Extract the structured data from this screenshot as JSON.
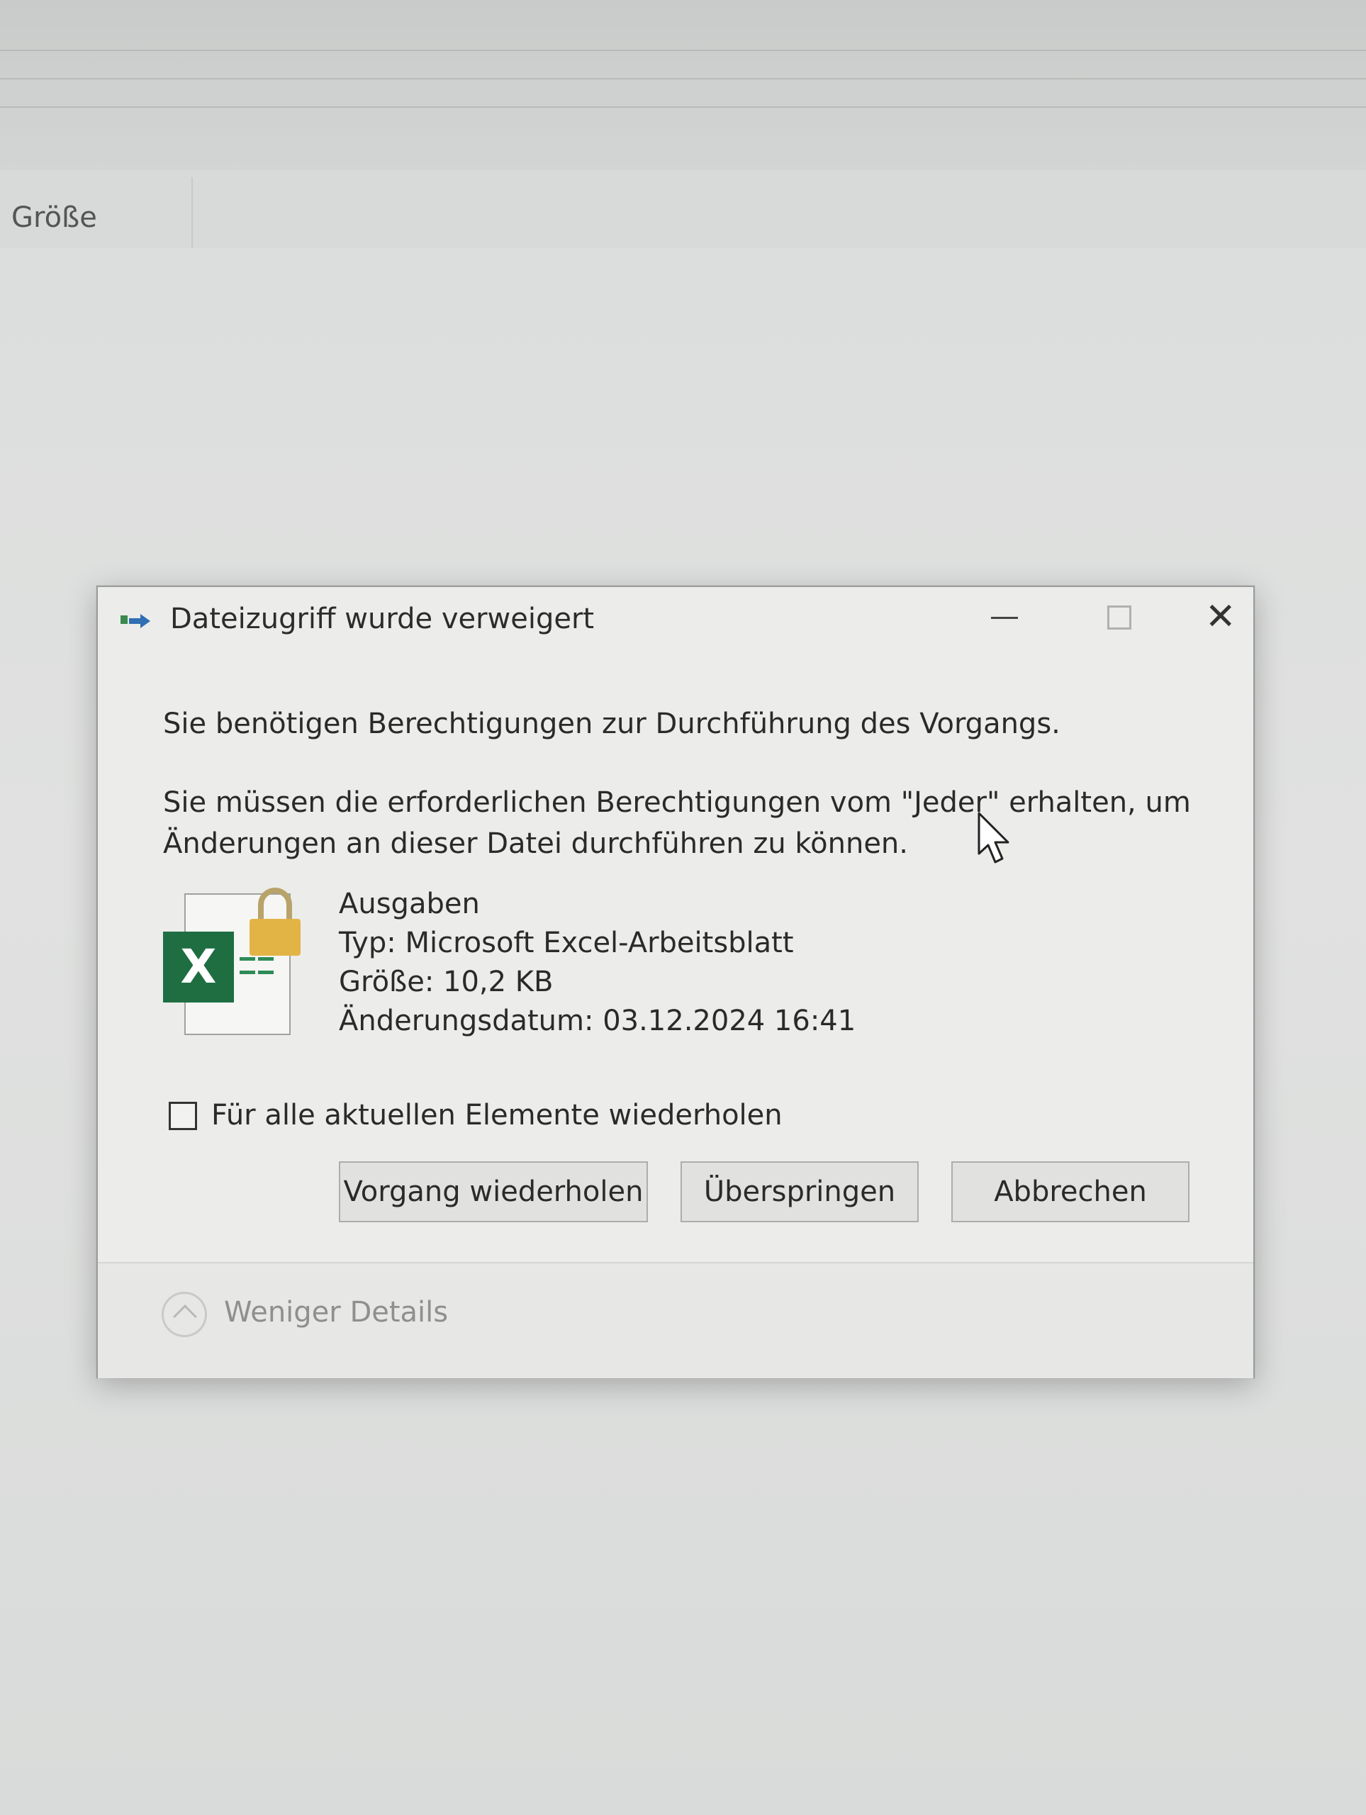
{
  "explorer": {
    "column_header": "Größe"
  },
  "dialog": {
    "title": "Dateizugriff wurde verweigert",
    "title_icon": "file-move-icon",
    "message_primary": "Sie benötigen Berechtigungen zur Durchführung des Vorgangs.",
    "message_secondary": "Sie müssen die erforderlichen Berechtigungen vom \"Jeder\" erhalten, um Änderungen an dieser Datei durchführen zu können.",
    "file": {
      "icon": "excel-file-locked-icon",
      "name": "Ausgaben",
      "type": "Typ: Microsoft Excel-Arbeitsblatt",
      "size": "Größe: 10,2 KB",
      "modified": "Änderungsdatum: 03.12.2024 16:41"
    },
    "repeat_checkbox": {
      "label": "Für alle aktuellen Elemente wiederholen",
      "checked": false
    },
    "buttons": {
      "retry": "Vorgang wiederholen",
      "skip": "Überspringen",
      "cancel": "Abbrechen"
    },
    "details_toggle": "Weniger Details"
  },
  "colors": {
    "excel_green": "#1e6e42",
    "lock_gold": "#e2b446",
    "dialog_bg": "#ececea"
  }
}
